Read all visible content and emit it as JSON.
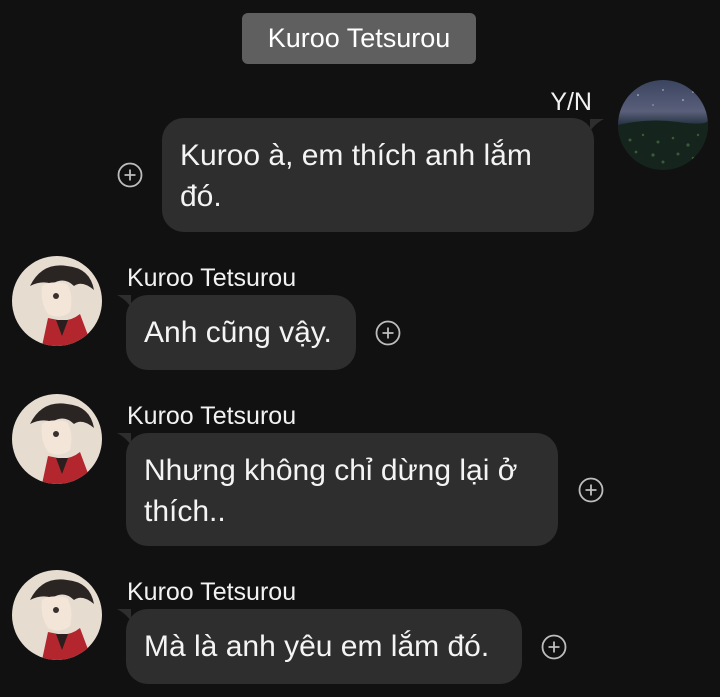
{
  "header": {
    "title": "Kuroo Tetsurou"
  },
  "messages": [
    {
      "sender": "Y/N",
      "text": "Kuroo à, em thích anh lắm đó.",
      "side": "right"
    },
    {
      "sender": "Kuroo Tetsurou",
      "text": "Anh cũng vậy.",
      "side": "left"
    },
    {
      "sender": "Kuroo Tetsurou",
      "text": "Nhưng không chỉ dừng lại ở thích..",
      "side": "left"
    },
    {
      "sender": "Kuroo Tetsurou",
      "text": "Mà là anh yêu em lắm đó.",
      "side": "left"
    }
  ],
  "icons": {
    "add_reaction": "plus-circle-icon",
    "user_avatar": "night-sky-field-avatar",
    "contact_avatar": "anime-character-avatar"
  },
  "colors": {
    "background": "#111112",
    "bubble": "#2e2e2e",
    "header_pill": "#5f5f5f",
    "text": "#ffffff"
  }
}
